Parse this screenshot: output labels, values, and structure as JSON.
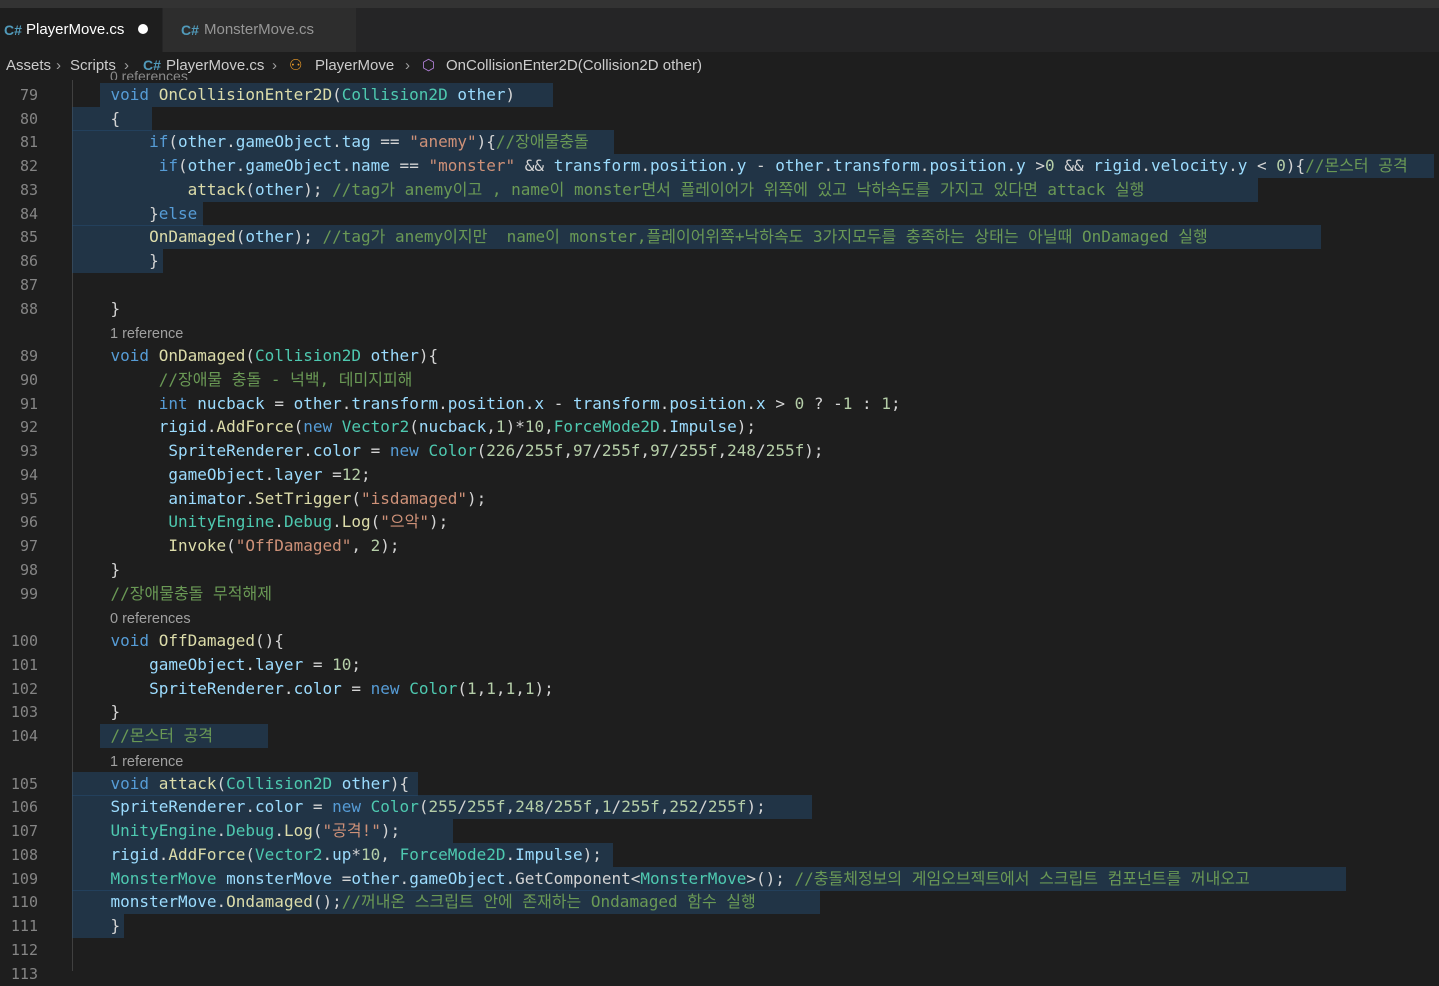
{
  "editor": {
    "tabs": [
      {
        "label": "PlayerMove.cs",
        "icon": "csharp-file-icon",
        "dirty": true
      },
      {
        "label": "MonsterMove.cs",
        "icon": "csharp-file-icon",
        "dirty": false
      }
    ],
    "breadcrumb": [
      "Assets",
      "Scripts",
      "PlayerMove.cs",
      "PlayerMove",
      "OnCollisionEnter2D(Collision2D other)"
    ],
    "partial_codelens": "0 references",
    "lines": [
      {
        "n": "79",
        "lens": null,
        "text": "    void OnCollisionEnter2D(Collision2D other)"
      },
      {
        "n": "80",
        "lens": null,
        "text": "    {"
      },
      {
        "n": "81",
        "lens": null,
        "text": "        if(other.gameObject.tag == \"anemy\"){//장애물충돌"
      },
      {
        "n": "82",
        "lens": null,
        "text": "         if(other.gameObject.name == \"monster\" && transform.position.y - other.transform.position.y >0 && rigid.velocity.y < 0){//몬스터 공격"
      },
      {
        "n": "83",
        "lens": null,
        "text": "            attack(other); //tag가 anemy이고 , name이 monster면서 플레이어가 위쪽에 있고 낙하속도를 가지고 있다면 attack 실행"
      },
      {
        "n": "84",
        "lens": null,
        "text": "        }else"
      },
      {
        "n": "85",
        "lens": null,
        "text": "        OnDamaged(other); //tag가 anemy이지만  name이 monster,플레이어위쪽+낙하속도 3가지모두를 충족하는 상태는 아닐때 OnDamaged 실행"
      },
      {
        "n": "86",
        "lens": null,
        "text": "        }"
      },
      {
        "n": "87",
        "lens": null,
        "text": ""
      },
      {
        "n": "88",
        "lens": null,
        "text": "    }"
      },
      {
        "n": "89",
        "lens": "1 reference",
        "text": "    void OnDamaged(Collision2D other){"
      },
      {
        "n": "90",
        "lens": null,
        "text": "         //장애물 충돌 - 넉백, 데미지피해"
      },
      {
        "n": "91",
        "lens": null,
        "text": "         int nucback = other.transform.position.x - transform.position.x > 0 ? -1 : 1;"
      },
      {
        "n": "92",
        "lens": null,
        "text": "         rigid.AddForce(new Vector2(nucback,1)*10,ForceMode2D.Impulse);"
      },
      {
        "n": "93",
        "lens": null,
        "text": "          SpriteRenderer.color = new Color(226/255f,97/255f,97/255f,248/255f);"
      },
      {
        "n": "94",
        "lens": null,
        "text": "          gameObject.layer =12;"
      },
      {
        "n": "95",
        "lens": null,
        "text": "          animator.SetTrigger(\"isdamaged\");"
      },
      {
        "n": "96",
        "lens": null,
        "text": "          UnityEngine.Debug.Log(\"으악\");"
      },
      {
        "n": "97",
        "lens": null,
        "text": "          Invoke(\"OffDamaged\", 2);"
      },
      {
        "n": "98",
        "lens": null,
        "text": "    }"
      },
      {
        "n": "99",
        "lens": null,
        "text": "    //장애물충돌 무적해제"
      },
      {
        "n": "100",
        "lens": "0 references",
        "text": "    void OffDamaged(){"
      },
      {
        "n": "101",
        "lens": null,
        "text": "        gameObject.layer = 10;"
      },
      {
        "n": "102",
        "lens": null,
        "text": "        SpriteRenderer.color = new Color(1,1,1,1);"
      },
      {
        "n": "103",
        "lens": null,
        "text": "    }"
      },
      {
        "n": "104",
        "lens": null,
        "text": "    //몬스터 공격"
      },
      {
        "n": "105",
        "lens": "1 reference",
        "text": "    void attack(Collision2D other){"
      },
      {
        "n": "106",
        "lens": null,
        "text": "    SpriteRenderer.color = new Color(255/255f,248/255f,1/255f,252/255f);"
      },
      {
        "n": "107",
        "lens": null,
        "text": "    UnityEngine.Debug.Log(\"공격!\");"
      },
      {
        "n": "108",
        "lens": null,
        "text": "    rigid.AddForce(Vector2.up*10, ForceMode2D.Impulse);"
      },
      {
        "n": "109",
        "lens": null,
        "text": "    MonsterMove monsterMove =other.gameObject.GetComponent<MonsterMove>(); //충돌체정보의 게임오브젝트에서 스크립트 컴포넌트를 꺼내오고"
      },
      {
        "n": "110",
        "lens": null,
        "text": "    monsterMove.Ondamaged();//꺼내온 스크립트 안에 존재하는 Ondamaged 함수 실행"
      },
      {
        "n": "111",
        "lens": null,
        "text": "    }"
      },
      {
        "n": "112",
        "lens": null,
        "text": ""
      },
      {
        "n": "113",
        "lens": null,
        "text": ""
      }
    ]
  },
  "colors": {
    "background": "#1e1e1e",
    "keyword": "#569cd6",
    "function": "#dcdcaa",
    "type": "#4ec9b0",
    "string": "#ce9178",
    "comment": "#6a9955",
    "number": "#b5cea8",
    "variable": "#9cdcfe",
    "control": "#c586c0",
    "selection": "#264f78"
  }
}
